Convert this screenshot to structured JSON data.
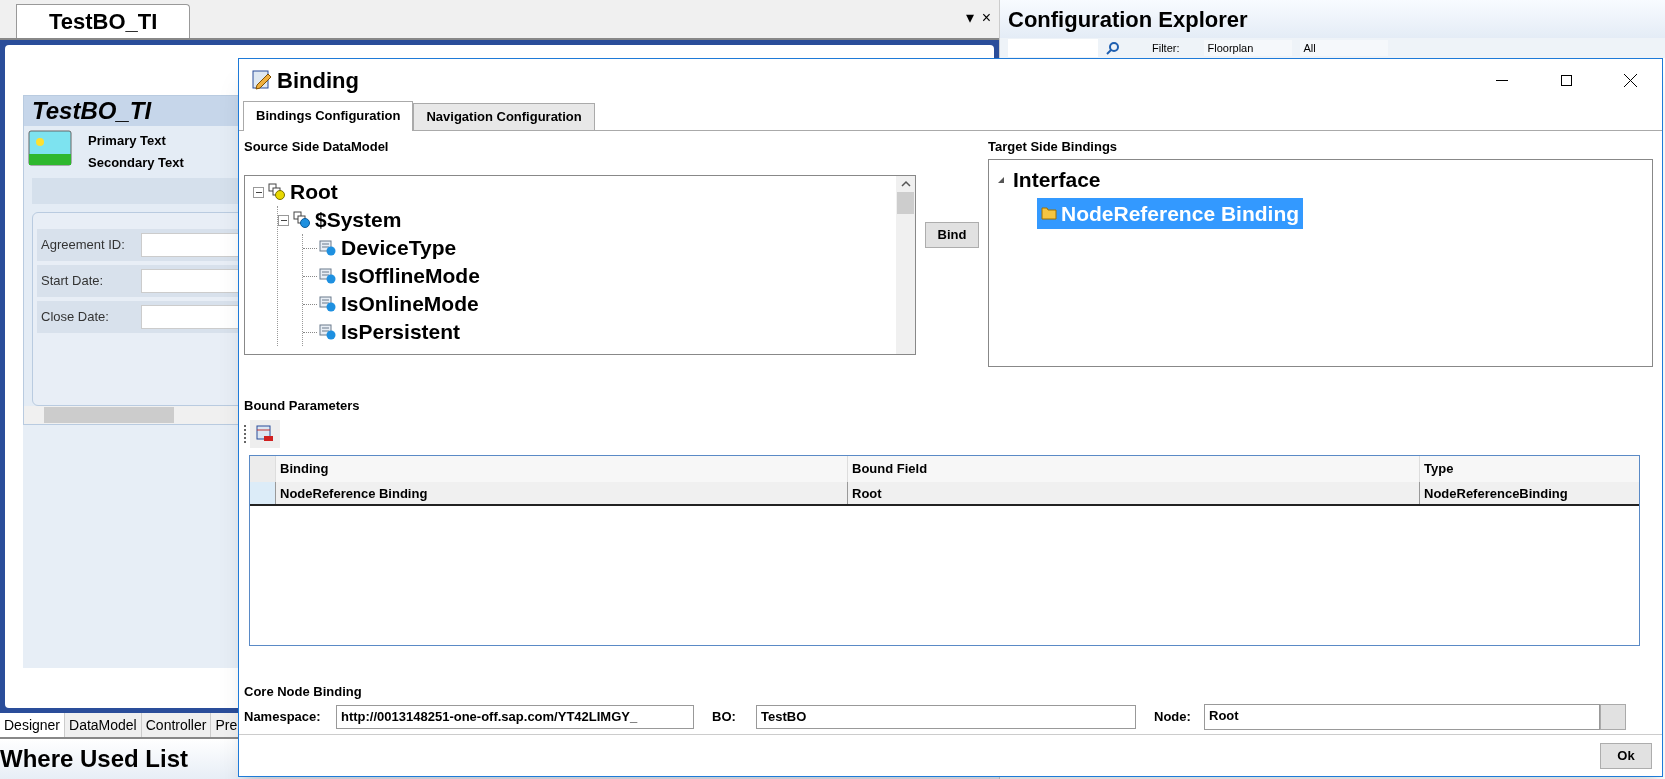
{
  "editor": {
    "tab": "TestBO_TI",
    "card_title": "TestBO_TI",
    "primary_text": "Primary Text",
    "secondary_text": "Secondary Text",
    "fields": [
      {
        "label": "Agreement ID:"
      },
      {
        "label": "Start Date:"
      },
      {
        "label": "Close Date:"
      }
    ],
    "bottom_tabs": [
      {
        "label": "Designer",
        "selected": true
      },
      {
        "label": "DataModel",
        "selected": false
      },
      {
        "label": "Controller",
        "selected": false
      },
      {
        "label": "Pre",
        "selected": false
      }
    ],
    "where_used_title": "Where Used List"
  },
  "tab_controls": {
    "menu": "▾",
    "close": "×"
  },
  "explorer": {
    "title": "Configuration Explorer",
    "filter_label": "Filter:",
    "filter_value": "Floorplan",
    "scope_value": "All"
  },
  "dialog": {
    "title": "Binding",
    "tabs": [
      {
        "label": "Bindings Configuration",
        "selected": true
      },
      {
        "label": "Navigation Configuration",
        "selected": false
      }
    ],
    "source_label": "Source Side DataModel",
    "source_tree": [
      {
        "label": "Root",
        "kind": "root",
        "expanded": true,
        "selected": false,
        "children": [
          {
            "label": "$System",
            "kind": "node",
            "expanded": true,
            "selected": false,
            "children": [
              {
                "label": "DeviceType",
                "kind": "field",
                "selected": false
              },
              {
                "label": "IsOfflineMode",
                "kind": "field",
                "selected": false
              },
              {
                "label": "IsOnlineMode",
                "kind": "field",
                "selected": false
              },
              {
                "label": "IsPersistent",
                "kind": "field",
                "selected": false
              }
            ]
          }
        ]
      }
    ],
    "bind_button": "Bind",
    "target_label": "Target Side Bindings",
    "target_tree": [
      {
        "label": "Interface",
        "expanded": true,
        "children": [
          {
            "label": "NodeReference Binding",
            "selected": true
          }
        ]
      }
    ],
    "bound_label": "Bound Parameters",
    "table": {
      "columns": [
        "Binding",
        "Bound Field",
        "Type"
      ],
      "rows": [
        [
          "NodeReference Binding",
          "Root",
          "NodeReferenceBinding"
        ]
      ]
    },
    "core_label": "Core Node Binding",
    "namespace_label": "Namespace:",
    "namespace_value": "http://0013148251-one-off.sap.com/YT42LIMGY_",
    "bo_label": "BO:",
    "bo_value": "TestBO",
    "node_label": "Node:",
    "node_value": "Root",
    "ok_button": "Ok"
  }
}
